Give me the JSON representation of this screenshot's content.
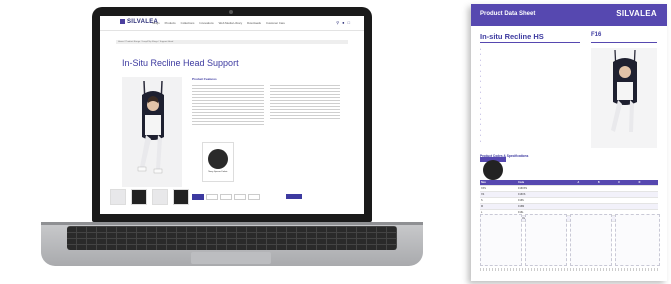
{
  "website": {
    "brand": "SILVALEA",
    "nav": [
      "Slings",
      "Products",
      "Collections",
      "Innovations",
      "Web Media Library",
      "Downloads",
      "Customer Care"
    ],
    "icons": [
      "search-icon",
      "user-icon",
      "cart-icon"
    ],
    "breadcrumb": "Home / Product Range / Loop/Clip Slings / Support Head",
    "page_title": "In-Situ Recline Head Support",
    "description_heading": "Product Features",
    "swatch_label": "Navy Spacer Fabric"
  },
  "datasheet": {
    "header_title": "Product Data Sheet",
    "brand": "SILVALEA",
    "product_title": "In-situ Recline HS",
    "product_code": "F16",
    "subheading": "Product Codes & Specifications",
    "table_headers": [
      "Size",
      "Code",
      "A",
      "B",
      "C",
      "D"
    ],
    "table_rows": [
      [
        "XXS",
        "F16XXS",
        "",
        "",
        "",
        ""
      ],
      [
        "XS",
        "F16XS",
        "",
        "",
        "",
        ""
      ],
      [
        "S",
        "F16S",
        "",
        "",
        "",
        ""
      ],
      [
        "M",
        "F16M",
        "",
        "",
        "",
        ""
      ],
      [
        "L",
        "F16L",
        "",
        "",
        "",
        ""
      ],
      [
        "XL",
        "F16XL",
        "",
        "",
        "",
        ""
      ],
      [
        "XXL",
        "F16XXL",
        "",
        "",
        "",
        ""
      ]
    ]
  },
  "colors": {
    "brand_purple": "#5648b0",
    "brand_navy": "#2c2f78",
    "laptop_bezel": "#1a1a1a",
    "laptop_body": "#b8b9bc"
  }
}
